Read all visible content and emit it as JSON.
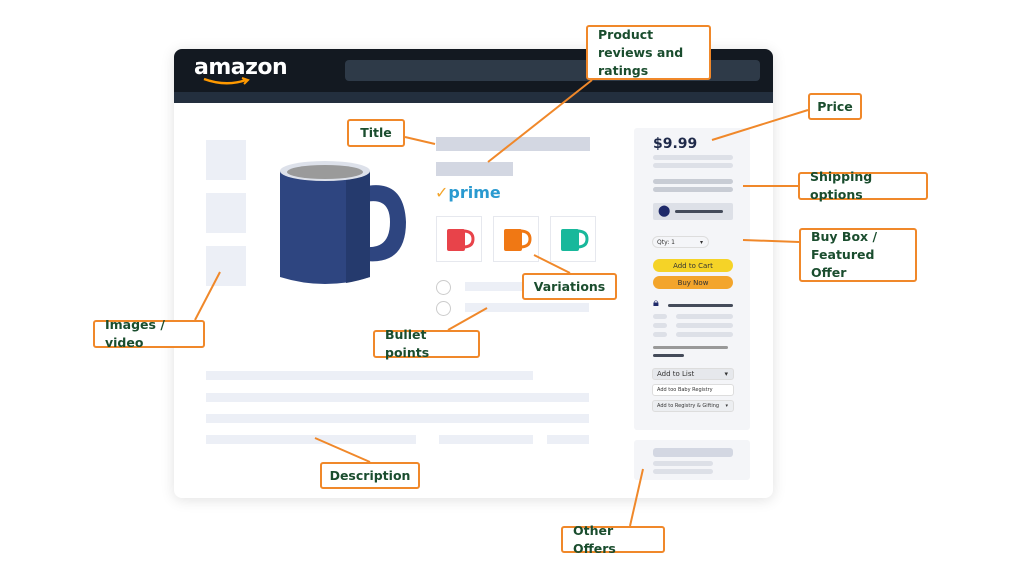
{
  "header": {
    "logo": "amazon"
  },
  "product": {
    "prime": "prime",
    "variation_colors": [
      "#e8434a",
      "#f07814",
      "#18b89b"
    ],
    "mug_color": "#2e4580"
  },
  "buybox": {
    "price": "$9.99",
    "qty": "Qty: 1",
    "add_to_cart": "Add to Cart",
    "buy_now": "Buy Now",
    "add_to_list": "Add to List",
    "baby_registry": "Add too Baby Registry",
    "registry_gifting": "Add to Registry & Gifting"
  },
  "labels": {
    "reviews": "Product reviews and ratings",
    "title": "Title",
    "price": "Price",
    "shipping": "Shipping options",
    "buybox": "Buy Box / Featured Offer",
    "variations": "Variations",
    "bullets": "Bullet points",
    "images": "Images / video",
    "description": "Description",
    "other_offers": "Other Offers"
  },
  "colors": {
    "accent": "#f0882a",
    "label_text": "#1a4d2e",
    "header": "#131921",
    "add_to_cart": "#f5d327",
    "buy_now": "#f3a52c"
  }
}
